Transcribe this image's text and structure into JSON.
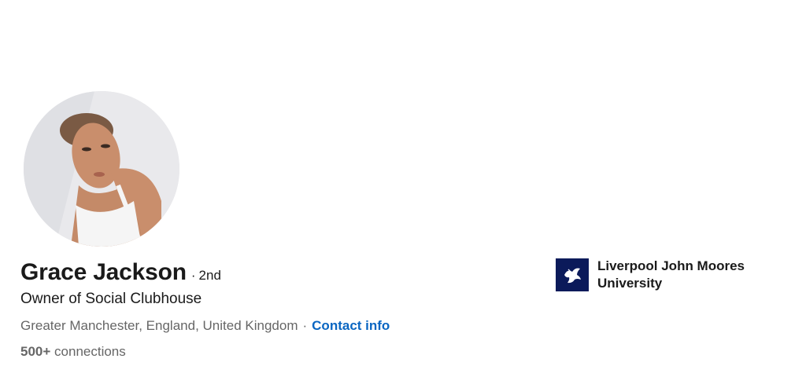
{
  "profile": {
    "name": "Grace Jackson",
    "degree_separator": "·",
    "degree": "2nd",
    "headline": "Owner of Social Clubhouse",
    "location": "Greater Manchester, England, United Kingdom",
    "location_separator": "·",
    "contact_link_label": "Contact info",
    "connections_count": "500+",
    "connections_label": "connections",
    "avatar_icon": "profile-photo"
  },
  "education": {
    "school_name": "Liverpool John Moores University",
    "logo_icon": "university-logo-bird-icon",
    "logo_color": "#0b1a5a"
  },
  "colors": {
    "link": "#0a66c2",
    "muted_text": "#666666",
    "primary_text": "#1a1a1a"
  }
}
